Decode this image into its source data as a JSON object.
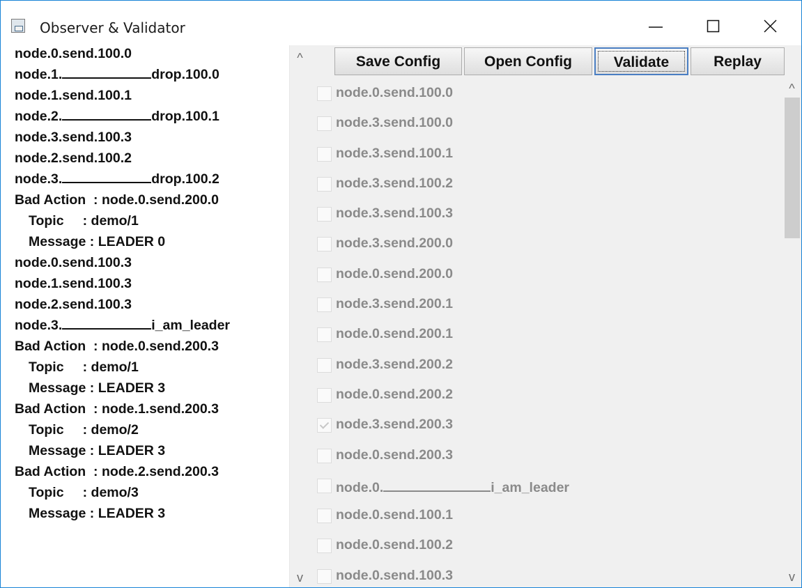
{
  "window": {
    "title": "Observer & Validator",
    "minimize_glyph": "—",
    "maximize_glyph": "☐",
    "close_glyph": "✕"
  },
  "toolbar": {
    "save_config": "Save Config",
    "open_config": "Open Config",
    "validate": "Validate",
    "replay": "Replay"
  },
  "log": [
    {
      "text": "node.0.send.100.0"
    },
    {
      "prefix": "node.1.",
      "suffix": "drop.100.0"
    },
    {
      "text": "node.1.send.100.1"
    },
    {
      "prefix": "node.2.",
      "suffix": "drop.100.1"
    },
    {
      "text": "node.3.send.100.3"
    },
    {
      "text": "node.2.send.100.2"
    },
    {
      "prefix": "node.3.",
      "suffix": "drop.100.2"
    },
    {
      "text": "Bad Action  : node.0.send.200.0"
    },
    {
      "text": "Topic     : demo/1",
      "indent": true
    },
    {
      "text": "Message : LEADER 0",
      "indent": true
    },
    {
      "text": "node.0.send.100.3"
    },
    {
      "text": "node.1.send.100.3"
    },
    {
      "text": "node.2.send.100.3"
    },
    {
      "prefix": "node.3.",
      "suffix": "i_am_leader"
    },
    {
      "text": "Bad Action  : node.0.send.200.3"
    },
    {
      "text": "Topic     : demo/1",
      "indent": true
    },
    {
      "text": "Message : LEADER 3",
      "indent": true
    },
    {
      "text": "Bad Action  : node.1.send.200.3"
    },
    {
      "text": "Topic     : demo/2",
      "indent": true
    },
    {
      "text": "Message : LEADER 3",
      "indent": true
    },
    {
      "text": "Bad Action  : node.2.send.200.3"
    },
    {
      "text": "Topic     : demo/3",
      "indent": true
    },
    {
      "text": "Message : LEADER 3",
      "indent": true
    }
  ],
  "checks": [
    {
      "label": "node.0.send.100.0",
      "checked": false
    },
    {
      "label": "node.3.send.100.0",
      "checked": false
    },
    {
      "label": "node.3.send.100.1",
      "checked": false
    },
    {
      "label": "node.3.send.100.2",
      "checked": false
    },
    {
      "label": "node.3.send.100.3",
      "checked": false
    },
    {
      "label": "node.3.send.200.0",
      "checked": false
    },
    {
      "label": "node.0.send.200.0",
      "checked": false
    },
    {
      "label": "node.3.send.200.1",
      "checked": false
    },
    {
      "label": "node.0.send.200.1",
      "checked": false
    },
    {
      "label": "node.3.send.200.2",
      "checked": false
    },
    {
      "label": "node.0.send.200.2",
      "checked": false
    },
    {
      "label": "node.3.send.200.3",
      "checked": true
    },
    {
      "label": "node.0.send.200.3",
      "checked": false
    },
    {
      "prefix": "node.0.",
      "suffix": "i_am_leader",
      "checked": false
    },
    {
      "label": "node.0.send.100.1",
      "checked": false
    },
    {
      "label": "node.0.send.100.2",
      "checked": false
    },
    {
      "label": "node.0.send.100.3",
      "checked": false
    }
  ],
  "scroll": {
    "up_glyph": "^",
    "down_glyph": "v"
  }
}
